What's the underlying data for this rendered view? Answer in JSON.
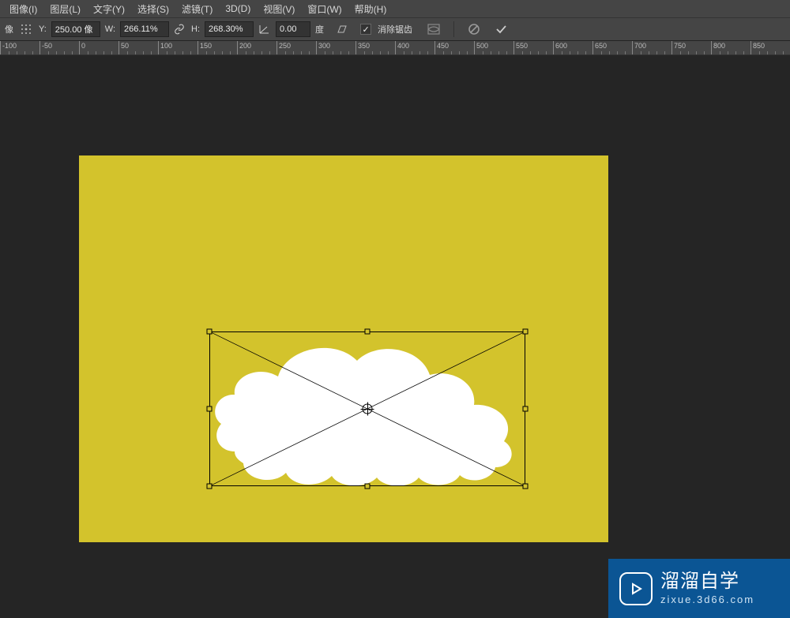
{
  "menu": {
    "items": [
      "图像(I)",
      "图层(L)",
      "文字(Y)",
      "选择(S)",
      "滤镜(T)",
      "3D(D)",
      "视图(V)",
      "窗口(W)",
      "帮助(H)"
    ]
  },
  "options": {
    "y_label": "Y:",
    "y_value": "250.00 像",
    "w_label": "W:",
    "w_value": "266.11%",
    "h_label": "H:",
    "h_value": "268.30%",
    "angle_value": "0.00",
    "angle_unit": "度",
    "antialias_label": "消除锯齿",
    "antialias_checked": "✓",
    "prefix_label": "像",
    "point_icon": "◬"
  },
  "ruler": {
    "start": -100,
    "step": 50,
    "count": 22
  },
  "canvas": {
    "bg_color": "#d3c32c",
    "cloud_color": "#ffffff"
  },
  "watermark": {
    "title": "溜溜自学",
    "sub": "zixue.3d66.com"
  }
}
